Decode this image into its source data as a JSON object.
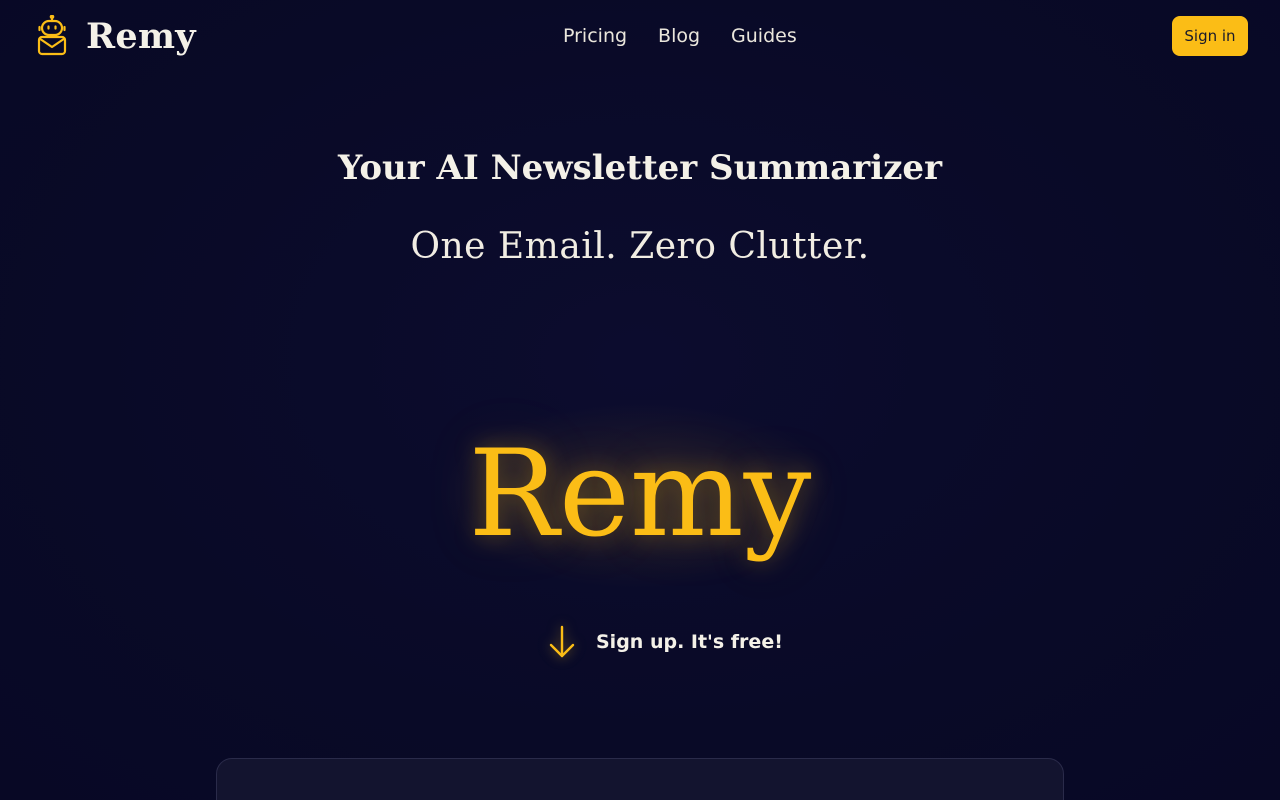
{
  "brand": {
    "name": "Remy",
    "icon": "robot-mail-icon",
    "accent_color": "#fbbd16"
  },
  "nav": {
    "items": [
      {
        "label": "Pricing"
      },
      {
        "label": "Blog"
      },
      {
        "label": "Guides"
      }
    ],
    "sign_in_label": "Sign in"
  },
  "hero": {
    "title": "Your AI Newsletter Summarizer",
    "subtitle": "One Email. Zero Clutter.",
    "brand_display": "Remy",
    "cta_label": "Sign up. It's free!",
    "cta_icon": "arrow-down-icon"
  },
  "colors": {
    "background": "#0b0b2a",
    "text": "#f4f1e8",
    "accent": "#fbbd16",
    "card": "#13142f"
  }
}
